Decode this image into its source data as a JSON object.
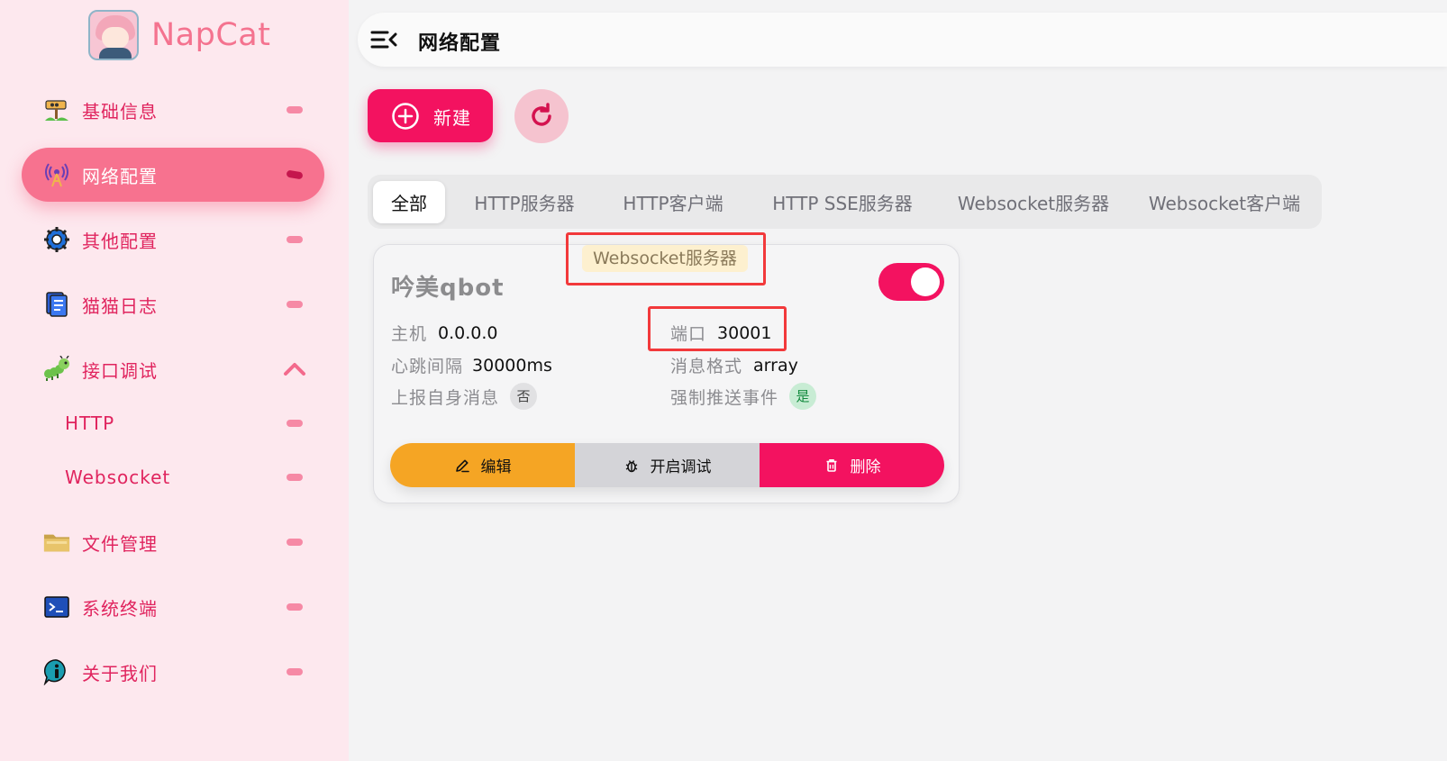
{
  "brand": {
    "name": "NapCat"
  },
  "sidebar": {
    "items": [
      {
        "label": "基础信息",
        "icon": "sign-post-icon"
      },
      {
        "label": "网络配置",
        "icon": "antenna-icon",
        "active": true
      },
      {
        "label": "其他配置",
        "icon": "gear-icon"
      },
      {
        "label": "猫猫日志",
        "icon": "log-book-icon"
      },
      {
        "label": "接口调试",
        "icon": "caterpillar-icon",
        "expanded": true
      },
      {
        "label": "HTTP"
      },
      {
        "label": "Websocket"
      },
      {
        "label": "文件管理",
        "icon": "folder-icon"
      },
      {
        "label": "系统终端",
        "icon": "terminal-icon"
      },
      {
        "label": "关于我们",
        "icon": "info-icon"
      }
    ]
  },
  "header": {
    "title": "网络配置"
  },
  "toolbar": {
    "new_label": "新建"
  },
  "tabs": [
    {
      "label": "全部",
      "active": true
    },
    {
      "label": "HTTP服务器"
    },
    {
      "label": "HTTP客户端"
    },
    {
      "label": "HTTP SSE服务器"
    },
    {
      "label": "Websocket服务器"
    },
    {
      "label": "Websocket客户端"
    }
  ],
  "card": {
    "type": "Websocket服务器",
    "name": "吟美qbot",
    "enabled": true,
    "fields": {
      "host_label": "主机",
      "host": "0.0.0.0",
      "port_label": "端口",
      "port": "30001",
      "heartbeat_label": "心跳间隔",
      "heartbeat": "30000ms",
      "format_label": "消息格式",
      "format": "array",
      "report_self_label": "上报自身消息",
      "report_self": "否",
      "force_push_label": "强制推送事件",
      "force_push": "是"
    },
    "actions": {
      "edit": "编辑",
      "debug": "开启调试",
      "delete": "删除"
    }
  },
  "colors": {
    "primary": "#f31260",
    "warning": "#f5a524",
    "sidebar_bg": "#fde8ee",
    "annotation": "#f2393b"
  }
}
